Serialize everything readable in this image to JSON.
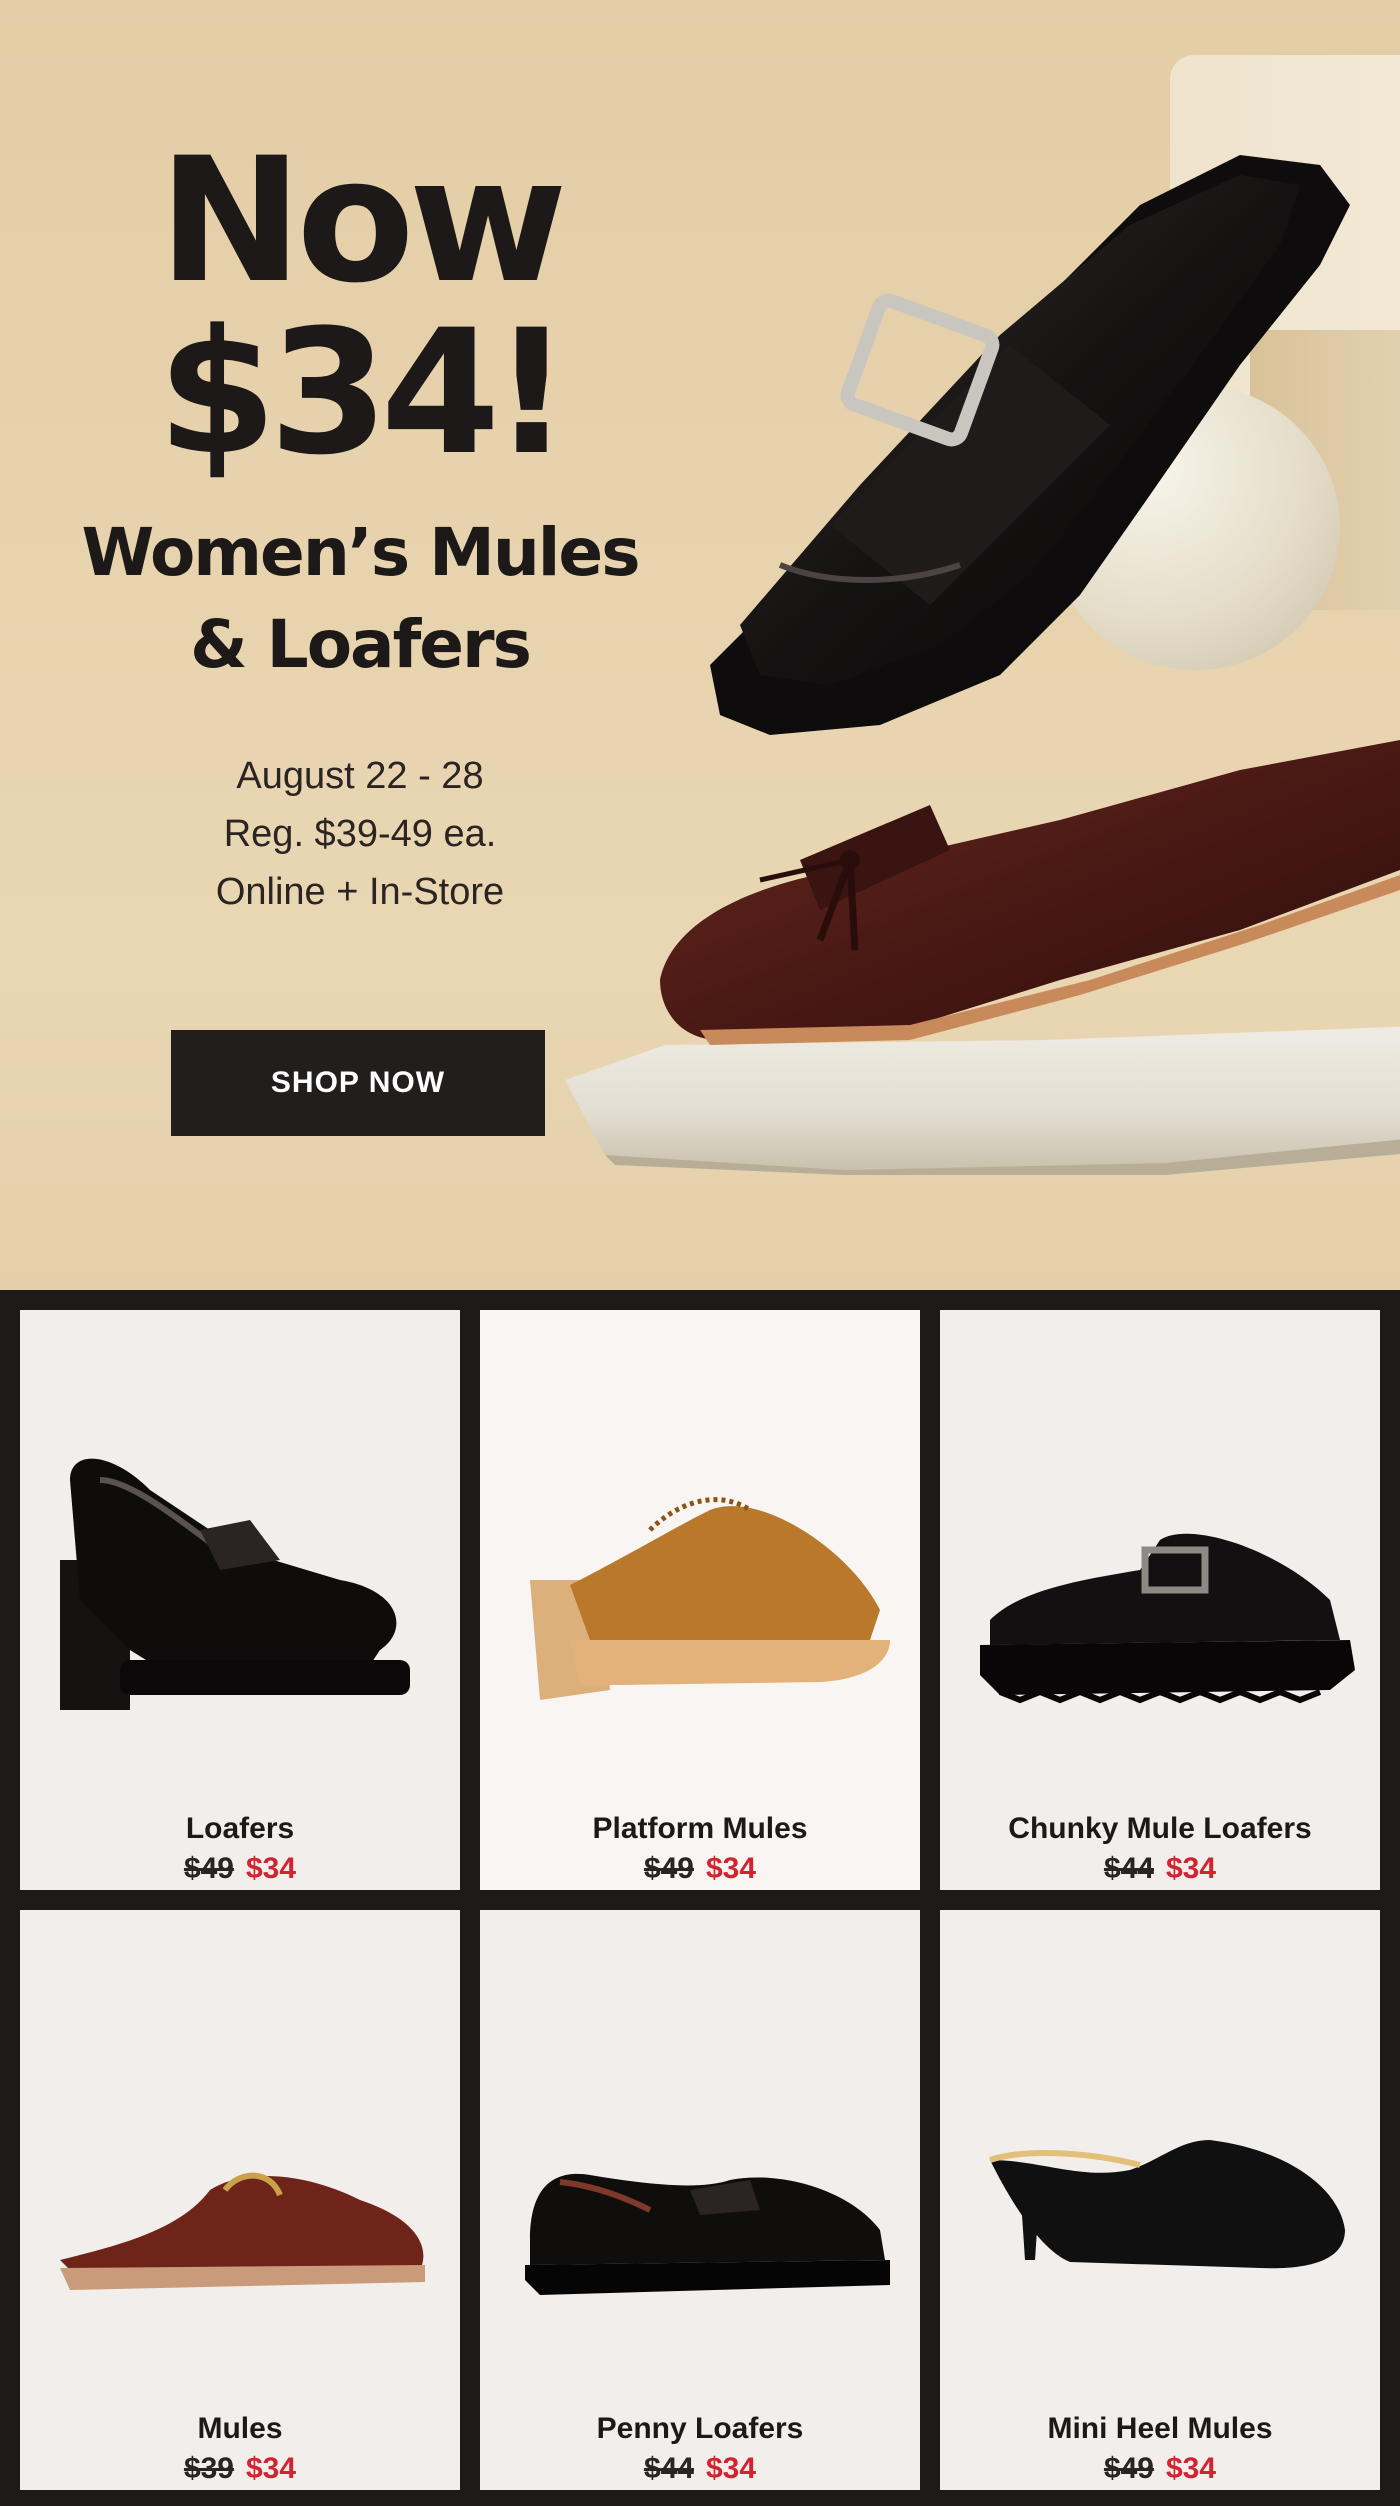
{
  "hero": {
    "headline_1": "Now",
    "headline_2": "$34!",
    "subheadline_1": "Women’s Mules",
    "subheadline_2": "& Loafers",
    "dates": "August 22 - 28",
    "regular_price": "Reg. $39-49 ea.",
    "availability": "Online + In-Store",
    "cta_label": "SHOP NOW",
    "background_color": "#e6d2ad",
    "button_color": "#221e1d"
  },
  "products": [
    {
      "name": "Loafers",
      "old_price": "$49",
      "new_price": "$34",
      "image": "black-patent-heeled-loafer"
    },
    {
      "name": "Platform Mules",
      "old_price": "$49",
      "new_price": "$34",
      "image": "tan-suede-platform-mule"
    },
    {
      "name": "Chunky Mule Loafers",
      "old_price": "$44",
      "new_price": "$34",
      "image": "black-buckle-chunky-mule"
    },
    {
      "name": "Mules",
      "old_price": "$39",
      "new_price": "$34",
      "image": "brown-horsebit-mule"
    },
    {
      "name": "Penny Loafers",
      "old_price": "$44",
      "new_price": "$34",
      "image": "black-patent-penny-loafer"
    },
    {
      "name": "Mini Heel Mules",
      "old_price": "$49",
      "new_price": "$34",
      "image": "black-mini-heel-mule"
    }
  ],
  "colors": {
    "sale_red": "#d42231",
    "text_dark": "#1c1918",
    "grid_border": "#1e1a19"
  }
}
